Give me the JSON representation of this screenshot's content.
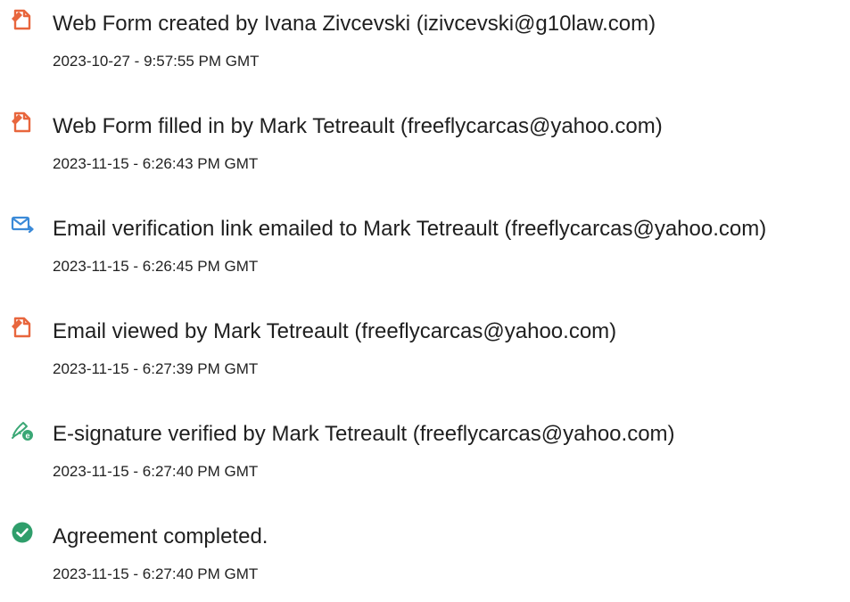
{
  "audit_history": [
    {
      "icon": "document-icon",
      "event": "Web Form created by Ivana Zivcevski (izivcevski@g10law.com)",
      "timestamp": "2023-10-27 - 9:57:55 PM GMT"
    },
    {
      "icon": "document-icon",
      "event": "Web Form filled in by Mark Tetreault (freeflycarcas@yahoo.com)",
      "timestamp": "2023-11-15 - 6:26:43 PM GMT"
    },
    {
      "icon": "email-send-icon",
      "event": "Email verification link emailed to Mark Tetreault (freeflycarcas@yahoo.com)",
      "timestamp": "2023-11-15 - 6:26:45 PM GMT"
    },
    {
      "icon": "document-icon",
      "event": "Email viewed by Mark Tetreault (freeflycarcas@yahoo.com)",
      "timestamp": "2023-11-15 - 6:27:39 PM GMT"
    },
    {
      "icon": "pen-e-signature-icon",
      "event": "E-signature verified by Mark Tetreault (freeflycarcas@yahoo.com)",
      "timestamp": "2023-11-15 - 6:27:40 PM GMT"
    },
    {
      "icon": "check-circle-icon",
      "event": "Agreement completed.",
      "timestamp": "2023-11-15 - 6:27:40 PM GMT"
    }
  ],
  "colors": {
    "document_icon": "#e8663d",
    "email_icon": "#3b8ad8",
    "signature_icon": "#3aa775",
    "check_icon": "#2f9e6b"
  }
}
